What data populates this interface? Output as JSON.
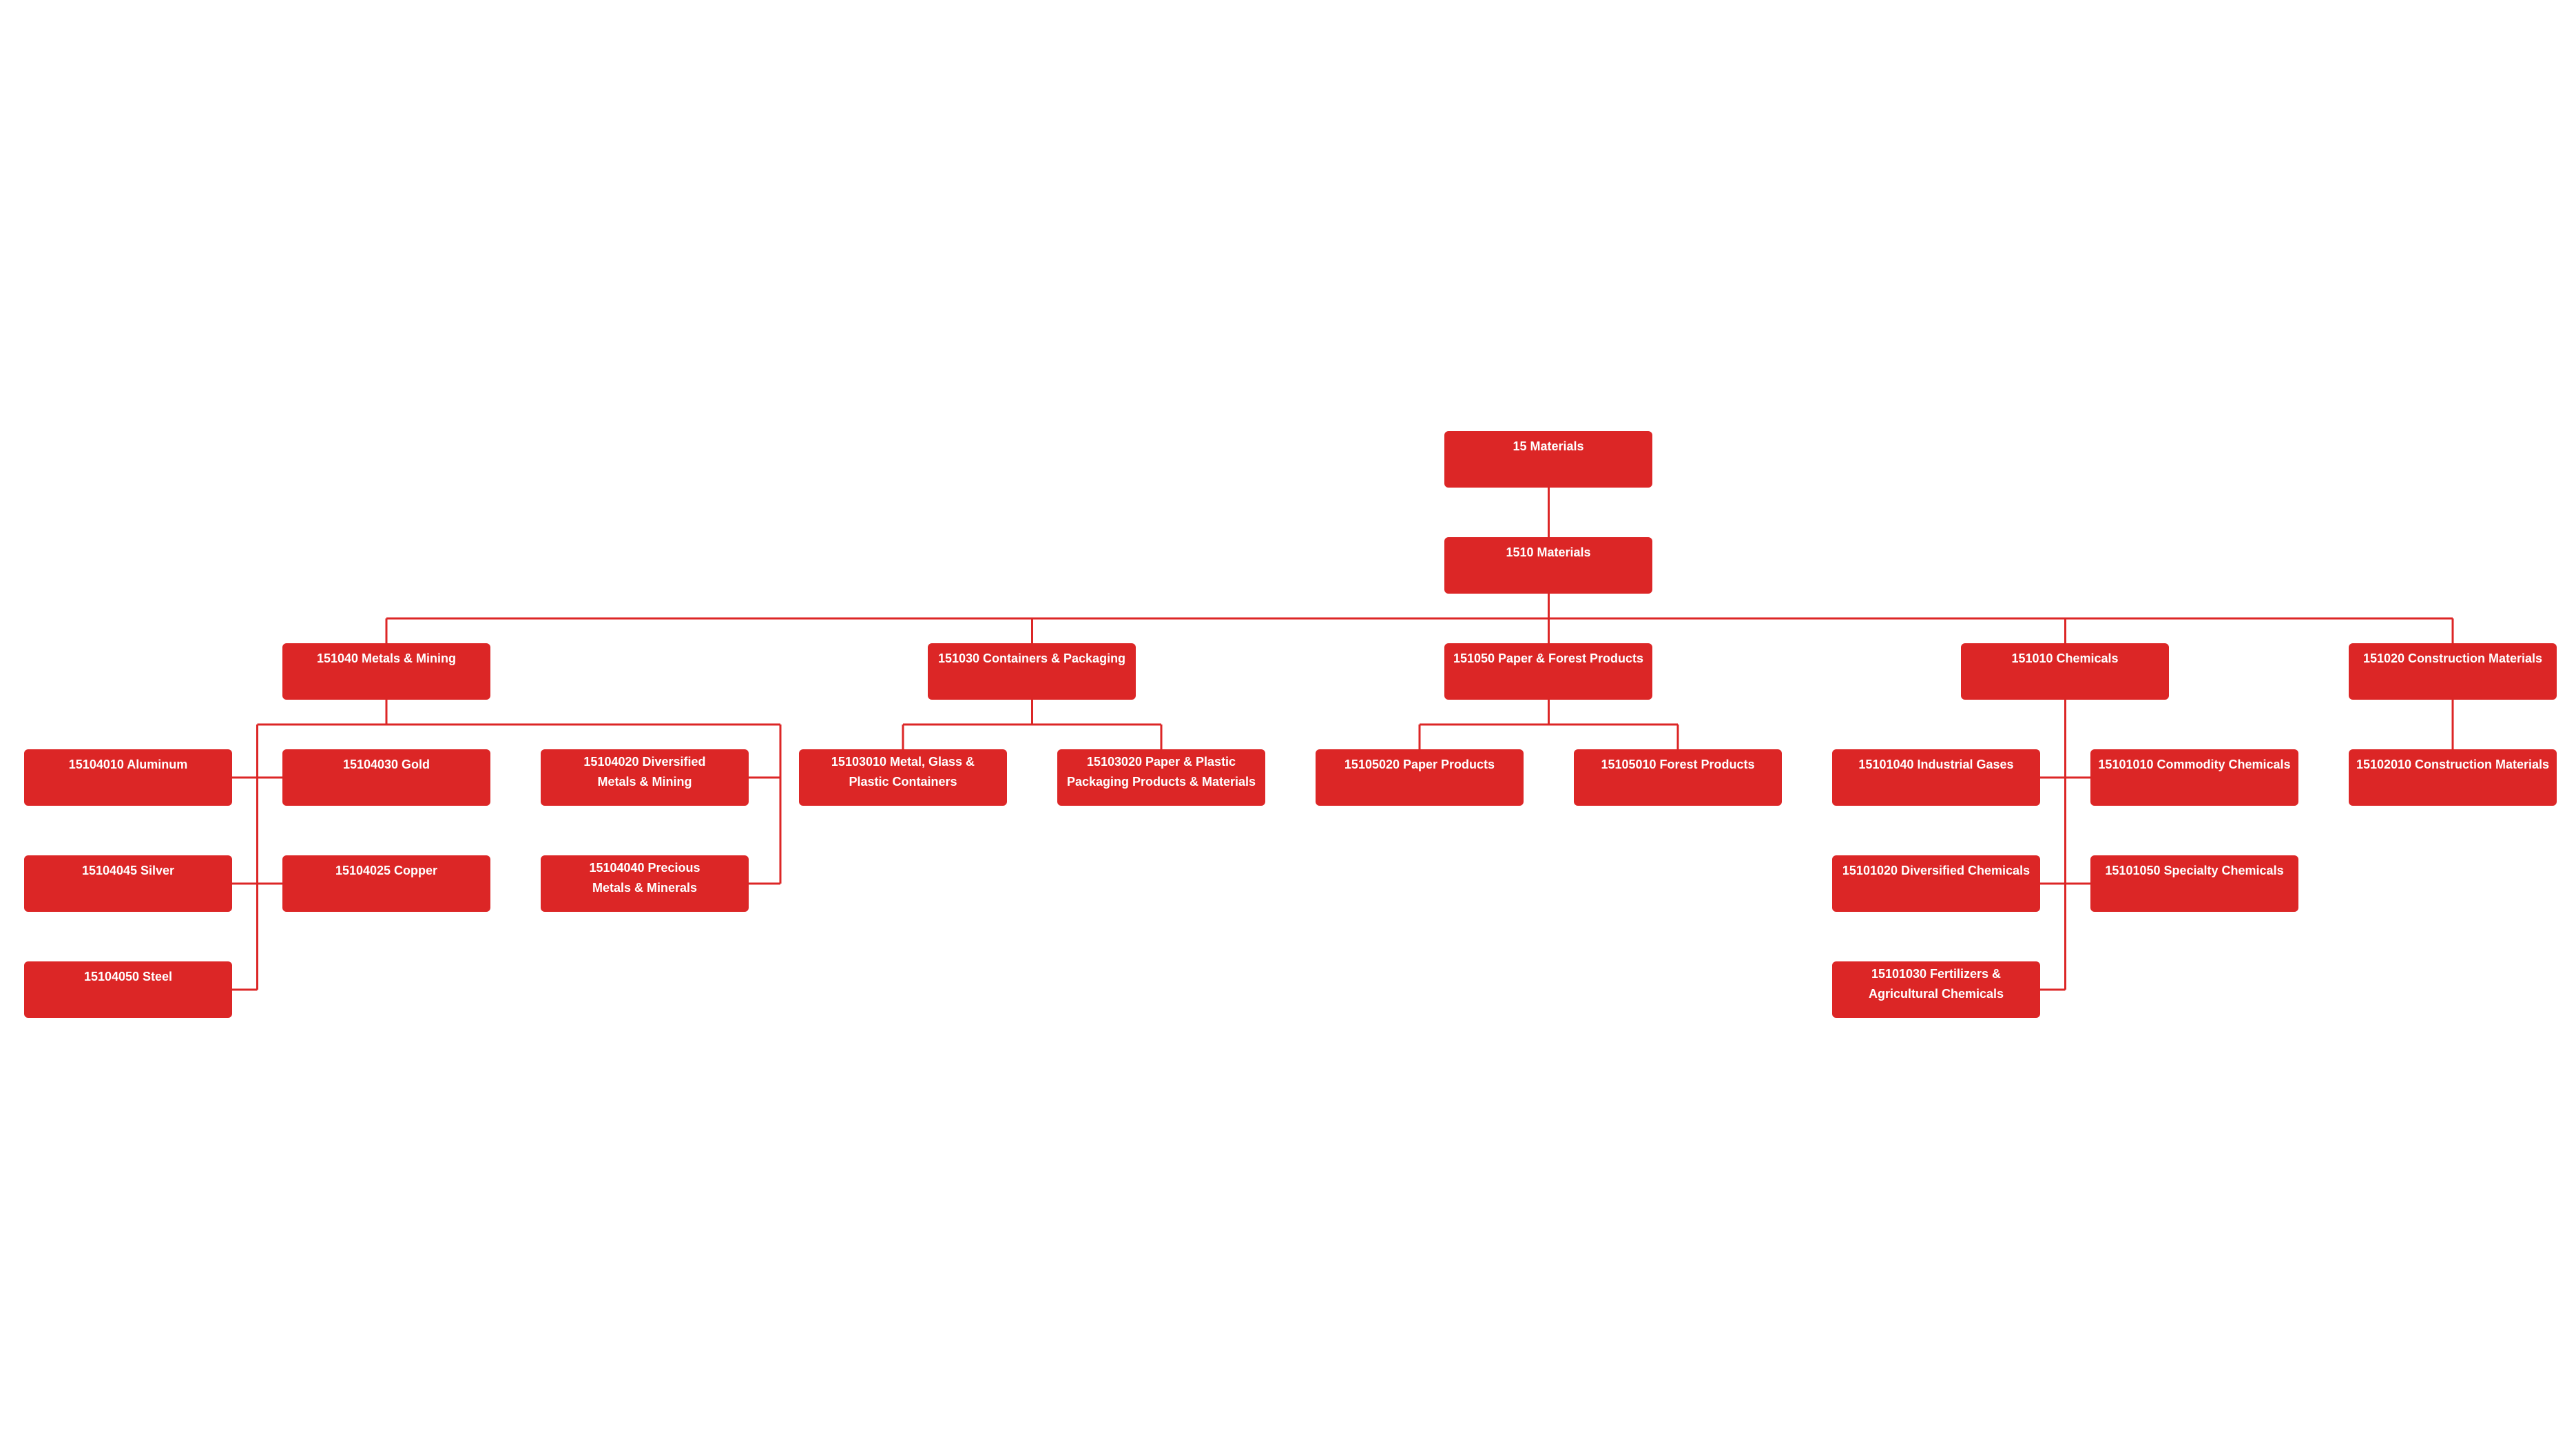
{
  "colors": {
    "node_fill": "#dc2626",
    "node_text": "#ffffff",
    "connector": "#dc2626",
    "background": "#ffffff"
  },
  "tree": {
    "sector": "15 Materials",
    "industry_group": "1510 Materials",
    "industries": {
      "metals_mining": {
        "label": "151040 Metals & Mining",
        "children": [
          "15104010 Aluminum",
          "15104030 Gold",
          "15104020 Diversified Metals & Mining",
          "15104045 Silver",
          "15104025 Copper",
          "15104040 Precious Metals & Minerals",
          "15104050 Steel"
        ]
      },
      "containers_packaging": {
        "label": "151030 Containers & Packaging",
        "children": [
          "15103010 Metal, Glass & Plastic Containers",
          "15103020 Paper & Plastic Packaging Products & Materials"
        ]
      },
      "paper_forest": {
        "label": "151050 Paper & Forest Products",
        "children": [
          "15105020 Paper Products",
          "15105010 Forest Products"
        ]
      },
      "chemicals": {
        "label": "151010 Chemicals",
        "children": [
          "15101040 Industrial Gases",
          "15101010 Commodity Chemicals",
          "15101020 Diversified Chemicals",
          "15101050 Specialty Chemicals",
          "15101030 Fertilizers & Agricultural Chemicals"
        ]
      },
      "construction_materials": {
        "label": "151020 Construction Materials",
        "children": [
          "15102010 Construction Materials"
        ]
      }
    }
  }
}
